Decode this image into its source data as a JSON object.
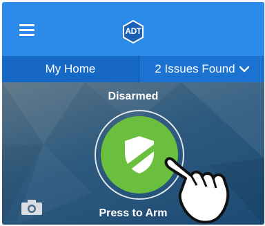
{
  "header": {
    "menu_icon": "hamburger-menu-icon",
    "logo_text": "ADT",
    "brand_color": "#2a8ce8"
  },
  "tabs": [
    {
      "label": "My Home"
    },
    {
      "label": "2 Issues Found"
    }
  ],
  "security": {
    "status": "Disarmed",
    "action_label": "Press to Arm",
    "arm_button_color": "#6bbf3f",
    "shield_icon": "shield-icon",
    "camera_icon": "camera-icon",
    "pointer_icon": "hand-pointer-icon"
  }
}
